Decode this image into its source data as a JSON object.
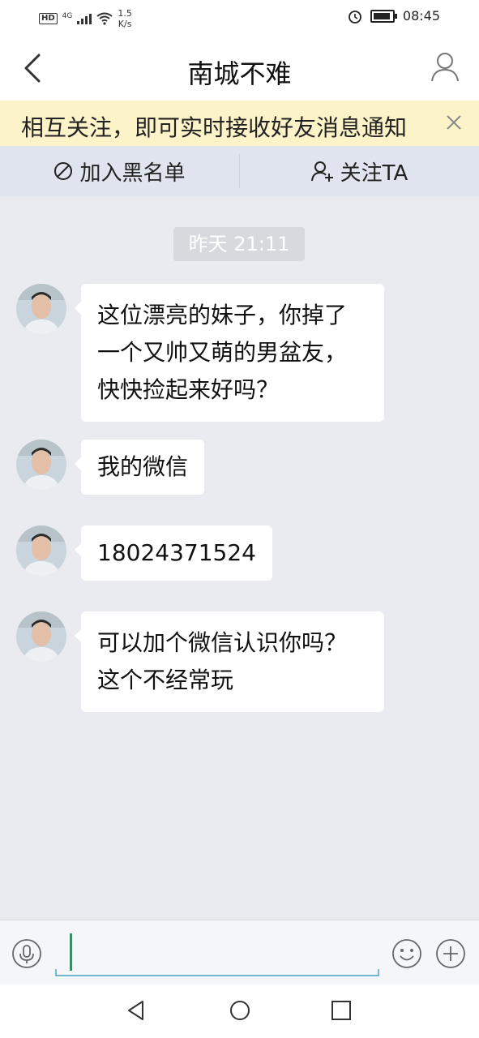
{
  "status_bar": {
    "network_badge": "HD",
    "network_type": "4G",
    "speed_value": "1.5",
    "speed_unit": "K/s",
    "time": "08:45",
    "battery_level": 0.9
  },
  "header": {
    "title": "南城不难"
  },
  "notice": {
    "text": "相互关注，即可实时接收好友消息通知"
  },
  "actions": {
    "block_label": "加入黑名单",
    "follow_label": "关注TA"
  },
  "chat": {
    "timestamp": "昨天 21:11",
    "messages": [
      {
        "text": "这位漂亮的妹子，你掉了一个又帅又萌的男盆友，快快捡起来好吗？"
      },
      {
        "text": "我的微信"
      },
      {
        "text": "18024371524"
      },
      {
        "text": "可以加个微信认识你吗？这个不经常玩"
      }
    ]
  },
  "input": {
    "value": ""
  },
  "icons": {
    "back": "back-chevron-icon",
    "profile": "person-icon",
    "close": "close-icon",
    "block": "forbidden-icon",
    "follow": "add-person-icon",
    "mic": "microphone-icon",
    "emoji": "smiley-icon",
    "plus": "plus-icon",
    "nav_back": "triangle-back-icon",
    "nav_home": "circle-home-icon",
    "nav_recent": "square-recent-icon"
  },
  "colors": {
    "notice_bg": "#fdf3c9",
    "action_bg": "#dfe4ef",
    "chat_bg": "#e9ebf0",
    "caret": "#3c8a6a"
  }
}
